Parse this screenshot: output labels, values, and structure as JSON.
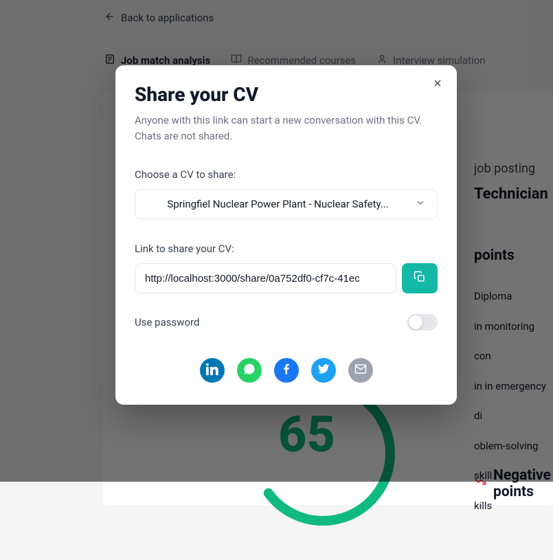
{
  "page": {
    "back_label": "Back to applications",
    "tabs": {
      "analysis": "Job match analysis",
      "courses": "Recommended courses",
      "interview": "Interview simulation"
    },
    "job_posting_label": "job posting",
    "job_title": "Technician",
    "positive_title": "points",
    "positive_items": [
      "Diploma",
      "in monitoring con",
      "in in emergency di",
      "oblem-solving skill",
      "kills"
    ],
    "negative_title": "Negative points",
    "score": "65"
  },
  "modal": {
    "title": "Share your CV",
    "subtitle": "Anyone with this link can start a new conversation with this CV. Chats are not shared.",
    "choose_label": "Choose a CV to share:",
    "selected_cv": "Springfiel Nuclear Power Plant - Nuclear Safety...",
    "link_label": "Link to share your CV:",
    "link_value": "http://localhost:3000/share/0a752df0-cf7c-41ec",
    "password_label": "Use password"
  }
}
